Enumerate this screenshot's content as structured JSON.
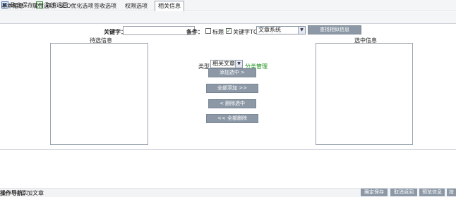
{
  "toolbar": {
    "save_label": "确定保存",
    "back_label": "取消返回"
  },
  "tabs": [
    {
      "label": "基本信息"
    },
    {
      "label": "属性选项"
    },
    {
      "label": "SEO优化选项"
    },
    {
      "label": "签收选项"
    },
    {
      "label": "权限选项"
    },
    {
      "label": "相关信息",
      "active": true
    }
  ],
  "search": {
    "keyword_label": "关键字：",
    "keyword_value": "",
    "condition_label": "条件：",
    "title_check_label": "标题",
    "title_checked": false,
    "tag_check_label": "关键字TGA",
    "tag_checked": true,
    "system_select": "文章系统",
    "search_button": "查找相似信息"
  },
  "candidate": {
    "title": "待选信息"
  },
  "selected": {
    "title": "选中信息"
  },
  "middle": {
    "type_label": "类型:",
    "type_select": "相关文章",
    "manage_link": "分类管理",
    "add_selected": "添加选中 >",
    "add_all": "全部添加 >>",
    "remove_selected": "< 删除选中",
    "remove_all": "<< 全部删除"
  },
  "status": {
    "nav_label": "操作导航：",
    "nav_value": "添加文章",
    "buttons": [
      "确定保存",
      "取消返回",
      "预览信息",
      "技"
    ]
  },
  "colors": {
    "button_bg": "#8c98a6",
    "link_green": "#178c17"
  }
}
